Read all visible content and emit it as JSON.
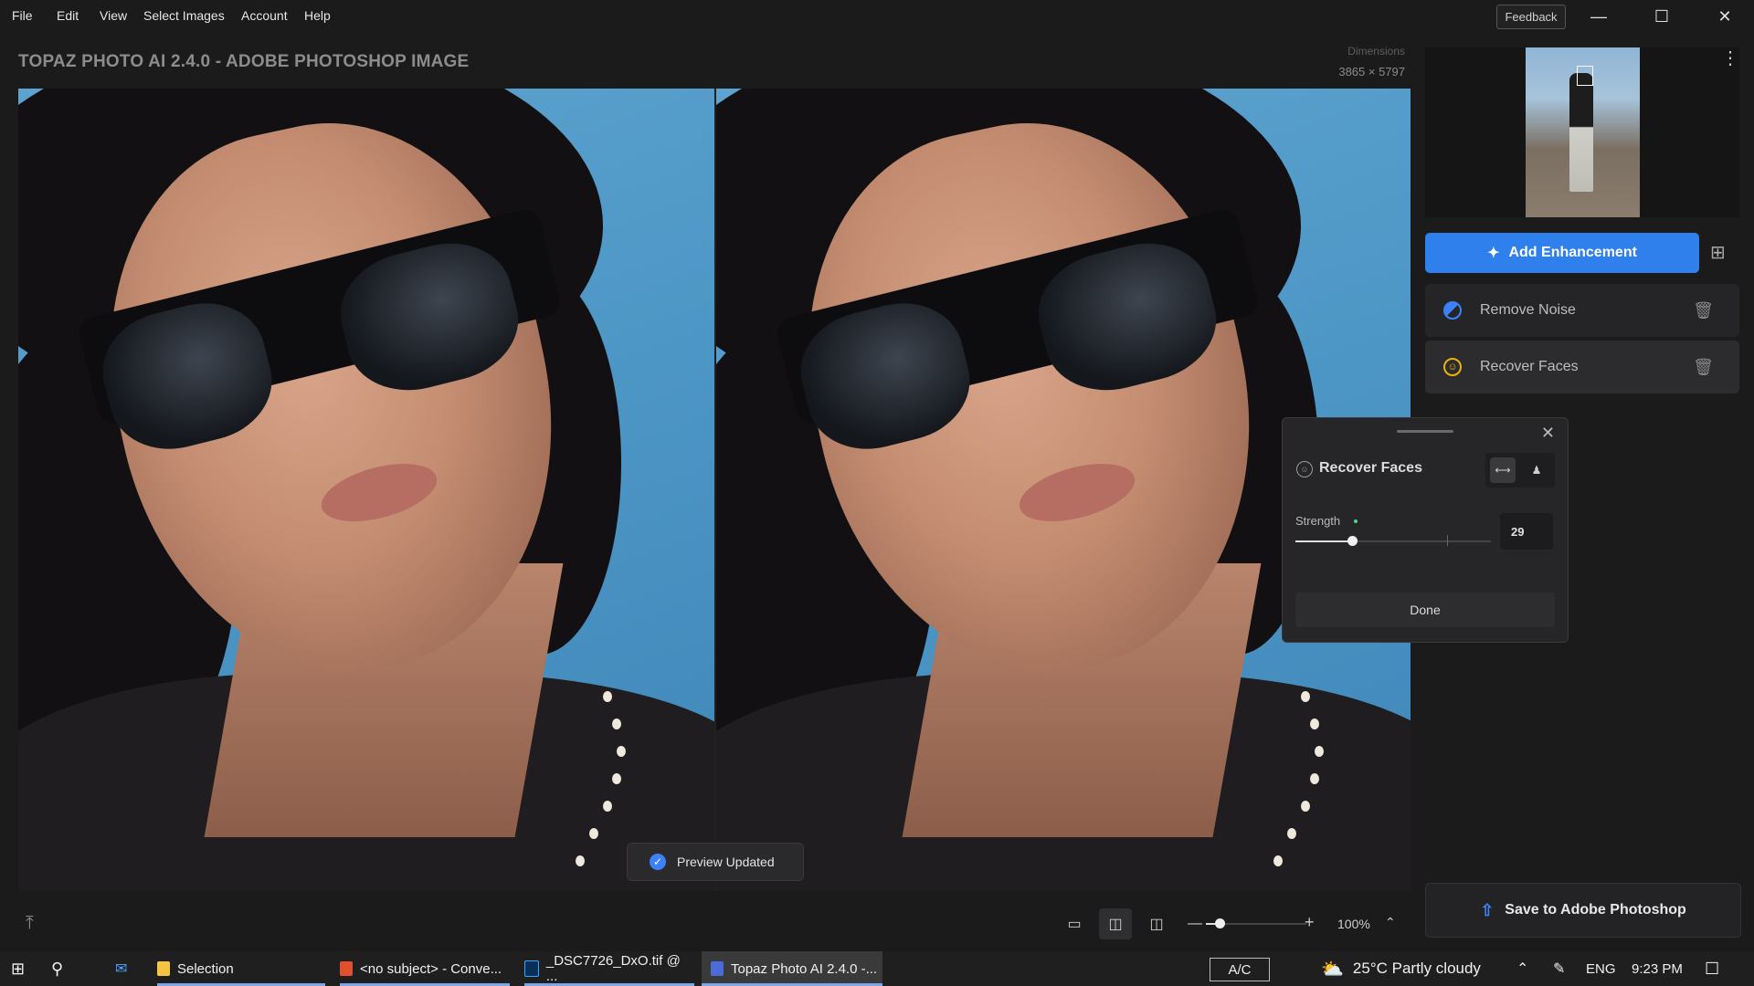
{
  "menu": {
    "items": [
      "File",
      "Edit",
      "View",
      "Select Images",
      "Account",
      "Help"
    ],
    "feedback": "Feedback"
  },
  "app_title": "TOPAZ PHOTO AI 2.4.0 - ADOBE PHOTOSHOP IMAGE",
  "dimensions": {
    "label": "Dimensions",
    "value": "3865 × 5797"
  },
  "toast": "Preview Updated",
  "panel": {
    "add_enhancement": "Add Enhancement",
    "enhancements": [
      {
        "label": "Remove Noise",
        "icon": "remove-noise-icon",
        "color": "#3b82f6"
      },
      {
        "label": "Recover Faces",
        "icon": "face-icon",
        "color": "#eab308"
      }
    ],
    "save": "Save to Adobe Photoshop"
  },
  "popup": {
    "title": "Recover Faces",
    "strength_label": "Strength",
    "strength_value": "29",
    "strength_fraction": 0.29,
    "done": "Done"
  },
  "toolbar": {
    "zoom": "100%"
  },
  "taskbar": {
    "items": [
      {
        "label": "Selection"
      },
      {
        "label": "<no subject> - Conve..."
      },
      {
        "label": "_DSC7726_DxO.tif @ ..."
      },
      {
        "label": "Topaz Photo AI 2.4.0 -..."
      }
    ],
    "ac": "A/C",
    "weather": "25°C  Partly cloudy",
    "lang": "ENG",
    "time": "9:23 PM"
  },
  "colors": {
    "accent": "#2f80ed",
    "background": "#1b1b1c"
  }
}
